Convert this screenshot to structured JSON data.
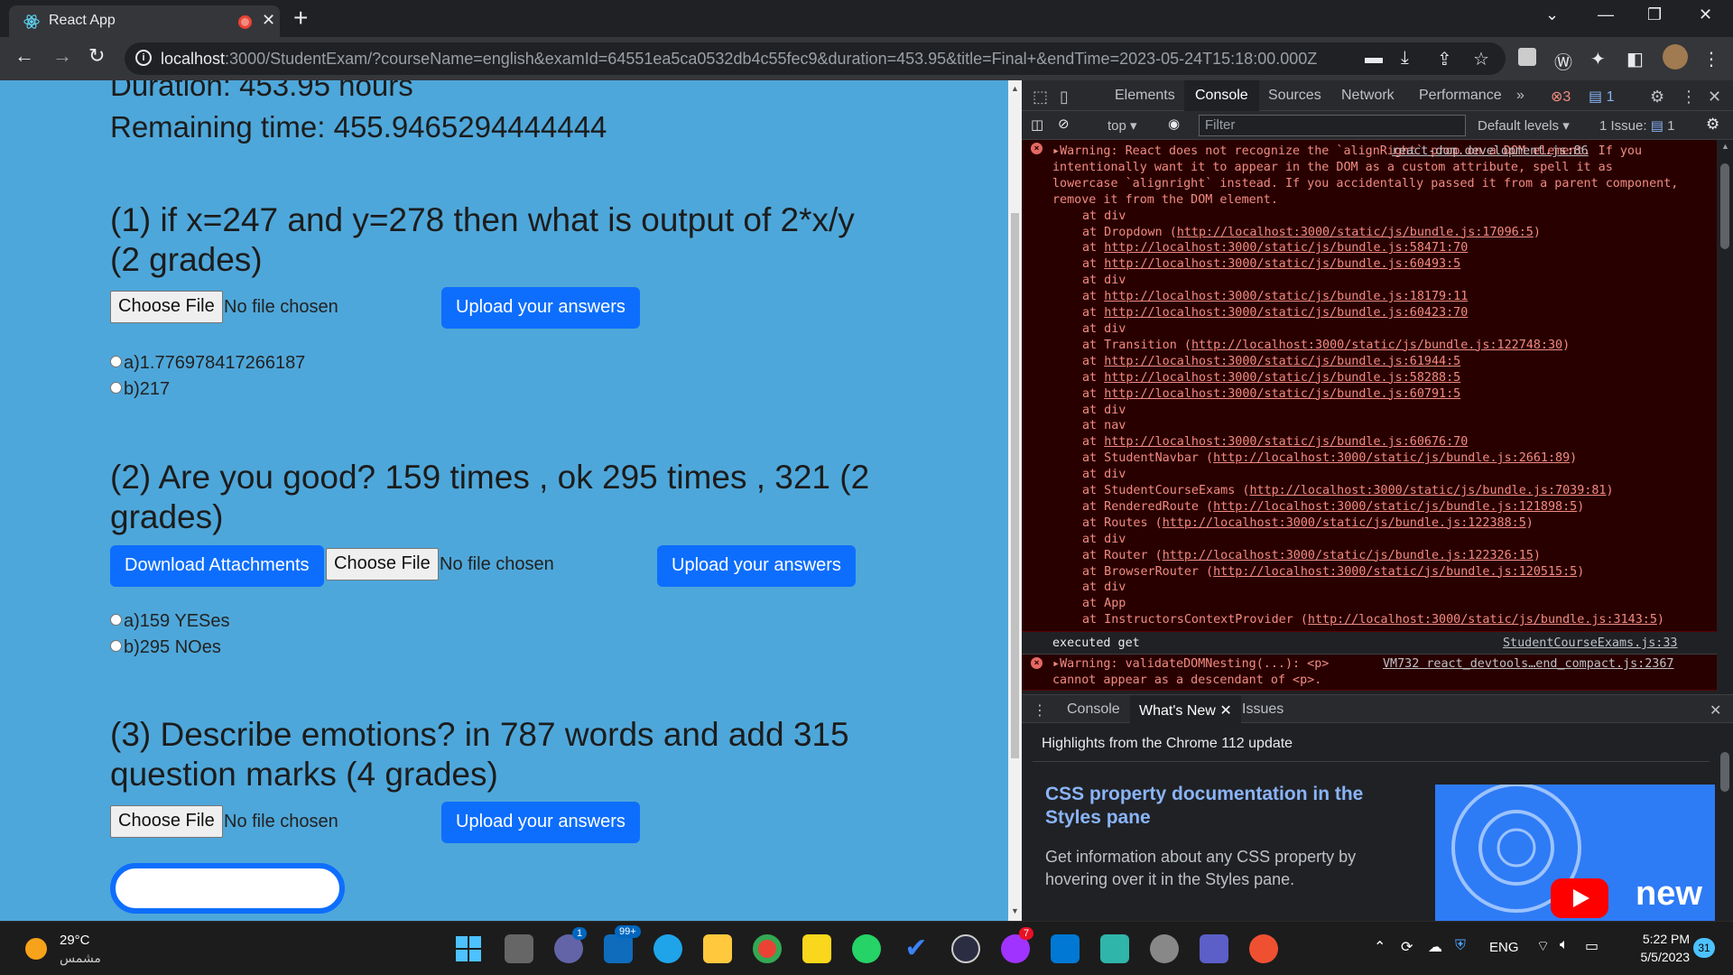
{
  "browser": {
    "tab_title": "React App",
    "url_host": "localhost",
    "url_rest": ":3000/StudentExam/?courseName=english&examId=64551ea5ca0532db4c55fec9&duration=453.95&title=Final+&endTime=2023-05-24T15:18:00.000Z"
  },
  "exam": {
    "duration_text": "Duration: 453.95 hours",
    "remaining_text": "Remaining time: 455.9465294444444",
    "choose_file_label": "Choose File",
    "no_file_label": "No file chosen",
    "upload_label": "Upload your answers",
    "download_label": "Download Attachments",
    "questions": [
      {
        "line1": "(1) if x=247 and y=278 then what is output of 2*x/y",
        "line2": "(2 grades)",
        "options": [
          "a)1.776978417266187",
          "b)217"
        ]
      },
      {
        "line1": "(2) Are you good? 159 times , ok 295 times , 321 (2",
        "line2": "grades)",
        "options": [
          "a)159 YESes",
          "b)295 NOes"
        ]
      },
      {
        "line1": "(3) Describe emotions? in 787 words and add 315",
        "line2": "question marks (4 grades)",
        "options": []
      }
    ]
  },
  "devtools": {
    "tabs": [
      "Elements",
      "Console",
      "Sources",
      "Network",
      "Performance"
    ],
    "more": "»",
    "error_count": "3",
    "message_count": "1",
    "context": "top",
    "filter_placeholder": "Filter",
    "levels": "Default levels",
    "issues": "1 Issue:",
    "issues_count": "1",
    "warning1": {
      "text": "Warning: React does not recognize the `alignRight` prop on a DOM element. If you intentionally want it to appear in the DOM as a custom attribute, spell it as lowercase `alignright` instead. If you accidentally passed it from a parent component, remove it from the DOM element.",
      "source": "react-dom.development.js:86",
      "stack": [
        [
          "at div",
          ""
        ],
        [
          "at Dropdown (",
          "http://localhost:3000/static/js/bundle.js:17096:5",
          ")"
        ],
        [
          "at ",
          "http://localhost:3000/static/js/bundle.js:58471:70",
          ""
        ],
        [
          "at ",
          "http://localhost:3000/static/js/bundle.js:60493:5",
          ""
        ],
        [
          "at div",
          ""
        ],
        [
          "at ",
          "http://localhost:3000/static/js/bundle.js:18179:11",
          ""
        ],
        [
          "at ",
          "http://localhost:3000/static/js/bundle.js:60423:70",
          ""
        ],
        [
          "at div",
          ""
        ],
        [
          "at Transition (",
          "http://localhost:3000/static/js/bundle.js:122748:30",
          ")"
        ],
        [
          "at ",
          "http://localhost:3000/static/js/bundle.js:61944:5",
          ""
        ],
        [
          "at ",
          "http://localhost:3000/static/js/bundle.js:58288:5",
          ""
        ],
        [
          "at ",
          "http://localhost:3000/static/js/bundle.js:60791:5",
          ""
        ],
        [
          "at div",
          ""
        ],
        [
          "at nav",
          ""
        ],
        [
          "at ",
          "http://localhost:3000/static/js/bundle.js:60676:70",
          ""
        ],
        [
          "at StudentNavbar (",
          "http://localhost:3000/static/js/bundle.js:2661:89",
          ")"
        ],
        [
          "at div",
          ""
        ],
        [
          "at StudentCourseExams (",
          "http://localhost:3000/static/js/bundle.js:7039:81",
          ")"
        ],
        [
          "at RenderedRoute (",
          "http://localhost:3000/static/js/bundle.js:121898:5",
          ")"
        ],
        [
          "at Routes (",
          "http://localhost:3000/static/js/bundle.js:122388:5",
          ")"
        ],
        [
          "at div",
          ""
        ],
        [
          "at Router (",
          "http://localhost:3000/static/js/bundle.js:122326:15",
          ")"
        ],
        [
          "at BrowserRouter (",
          "http://localhost:3000/static/js/bundle.js:120515:5",
          ")"
        ],
        [
          "at div",
          ""
        ],
        [
          "at App",
          ""
        ],
        [
          "at InstructorsContextProvider (",
          "http://localhost:3000/static/js/bundle.js:3143:5",
          ")"
        ]
      ]
    },
    "log": {
      "text": "executed get",
      "source": "StudentCourseExams.js:33"
    },
    "warning2": {
      "text": "Warning: validateDOMNesting(...): <p>",
      "text2": "cannot appear as a descendant of <p>.",
      "source": "VM732 react_devtools…end_compact.js:2367"
    },
    "drawer_tabs": [
      "Console",
      "What's New",
      "Issues"
    ],
    "whats_new": {
      "highlight": "Highlights from the Chrome 112 update",
      "title": "CSS property documentation in the Styles pane",
      "desc": "Get information about any CSS property by hovering over it in the Styles pane.",
      "image_text": "new"
    }
  },
  "taskbar": {
    "temp": "29°C",
    "weather": "مشمس",
    "lang": "ENG",
    "time": "5:22 PM",
    "date": "5/5/2023",
    "notif": "31",
    "teams_badge": "1",
    "mail_badge": "99+",
    "messenger_badge": "7"
  }
}
